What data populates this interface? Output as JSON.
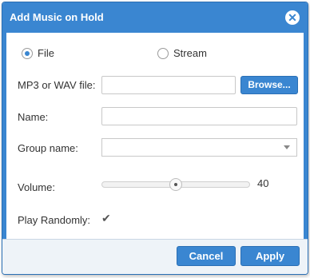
{
  "dialog": {
    "title": "Add Music on Hold",
    "close_icon": "close-icon"
  },
  "source": {
    "options": [
      {
        "label": "File",
        "checked": true
      },
      {
        "label": "Stream",
        "checked": false
      }
    ]
  },
  "form": {
    "file_label": "MP3 or WAV file:",
    "file_value": "",
    "browse_label": "Browse...",
    "name_label": "Name:",
    "name_value": "",
    "group_label": "Group name:",
    "group_value": "",
    "volume_label": "Volume:",
    "volume_value": "40",
    "volume_fraction": 0.5,
    "play_random_label": "Play Randomly:",
    "play_random_checked": true
  },
  "footer": {
    "cancel_label": "Cancel",
    "apply_label": "Apply"
  },
  "colors": {
    "accent": "#3a86d1",
    "accent_border": "#2a6fb5",
    "footer_bg": "#eef3f8"
  }
}
